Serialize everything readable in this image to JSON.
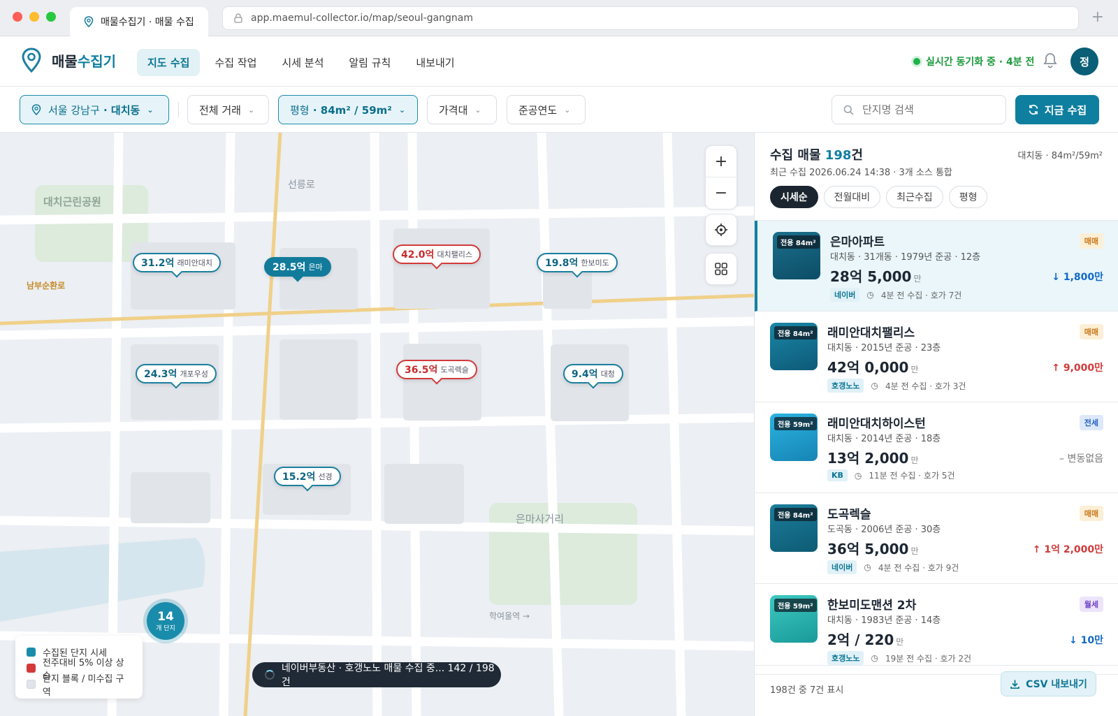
{
  "browser": {
    "tab_title": "매물수집기 · 매물 수집",
    "url": "app.maemul-collector.io/map/seoul-gangnam",
    "new_tab_glyph": "+"
  },
  "header": {
    "logo_part1": "매물",
    "logo_part2": "수집기",
    "nav": [
      "지도 수집",
      "수집 작업",
      "시세 분석",
      "알림 규칙",
      "내보내기"
    ],
    "sync_status": "실시간 동기화 중 · 4분 전",
    "avatar": "정"
  },
  "filters": {
    "region_prefix": "서울 강남구",
    "region_bold": "· 대치동",
    "deal_type": "전체 거래",
    "size_label": "평형",
    "size_value": "· 84m² / 59m²",
    "price": "가격대",
    "year": "준공연도",
    "search_placeholder": "단지명 검색",
    "collect_button": "지금 수집"
  },
  "map": {
    "labels": {
      "park1": "대치근린공원",
      "road1": "선릉로",
      "road2": "남부순환로",
      "park2": "은마사거리",
      "station": "학여울역 →"
    },
    "pins": [
      {
        "value": "31.2억",
        "name": "래미안대치"
      },
      {
        "value": "28.5억",
        "name": "은마"
      },
      {
        "value": "42.0억",
        "name": "대치팰리스"
      },
      {
        "value": "19.8억",
        "name": "한보미도"
      },
      {
        "value": "24.3억",
        "name": "개포우성"
      },
      {
        "value": "36.5억",
        "name": "도곡렉슬"
      },
      {
        "value": "9.4억",
        "name": "대청"
      },
      {
        "value": "15.2억",
        "name": "선경"
      }
    ],
    "controls": {
      "zoom_in": "+",
      "zoom_out": "−"
    },
    "cluster": {
      "count": "14",
      "unit": "개 단지"
    },
    "legend": [
      "수집된 단지 시세",
      "전주대비 5% 이상 상승",
      "단지 블록 / 미수집 구역"
    ],
    "toast": "네이버부동산 · 호갱노노 매물 수집 중... 142 / 198건"
  },
  "panel": {
    "title_prefix": "수집 매물",
    "title_count": "198",
    "title_suffix": "건",
    "meta": "대치동 · 84m²/59m²",
    "subtitle": "최근 수집 2026.06.24 14:38 · 3개 소스 통합",
    "sorts": [
      "시세순",
      "전월대비",
      "최근수집",
      "평형"
    ],
    "items": [
      {
        "size": "전용 84m²",
        "name": "은마아파트",
        "desc": "대치동 · 31개동 · 1979년 준공 · 12층",
        "price": "28억 5,000",
        "unit": "만",
        "source": "네이버",
        "meta": "4분 전 수집 · 호가 7건",
        "type": "매매",
        "change": "↓ 1,800만"
      },
      {
        "size": "전용 84m²",
        "name": "래미안대치팰리스",
        "desc": "대치동 · 2015년 준공 · 23층",
        "price": "42억 0,000",
        "unit": "만",
        "source": "호갱노노",
        "meta": "4분 전 수집 · 호가 3건",
        "type": "매매",
        "change": "↑ 9,000만"
      },
      {
        "size": "전용 59m²",
        "name": "래미안대치하이스턴",
        "desc": "대치동 · 2014년 준공 · 18층",
        "price": "13억 2,000",
        "unit": "만",
        "source": "KB",
        "meta": "11분 전 수집 · 호가 5건",
        "type": "전세",
        "change": "– 변동없음"
      },
      {
        "size": "전용 84m²",
        "name": "도곡렉슬",
        "desc": "도곡동 · 2006년 준공 · 30층",
        "price": "36억 5,000",
        "unit": "만",
        "source": "네이버",
        "meta": "4분 전 수집 · 호가 9건",
        "type": "매매",
        "change": "↑ 1억 2,000만"
      },
      {
        "size": "전용 59m²",
        "name": "한보미도맨션 2차",
        "desc": "대치동 · 1983년 준공 · 14층",
        "price": "2억 / 220",
        "unit": "만",
        "source": "호갱노노",
        "meta": "19분 전 수집 · 호가 2건",
        "type": "월세",
        "change": "↓ 10만"
      }
    ],
    "footer_count": "198건 중 7건 표시",
    "csv_button": "CSV 내보내기"
  },
  "colors": {
    "accent": "#0f7fa0",
    "up": "#d23a3a",
    "down": "#1269c7",
    "sync": "#1b9a3d"
  }
}
